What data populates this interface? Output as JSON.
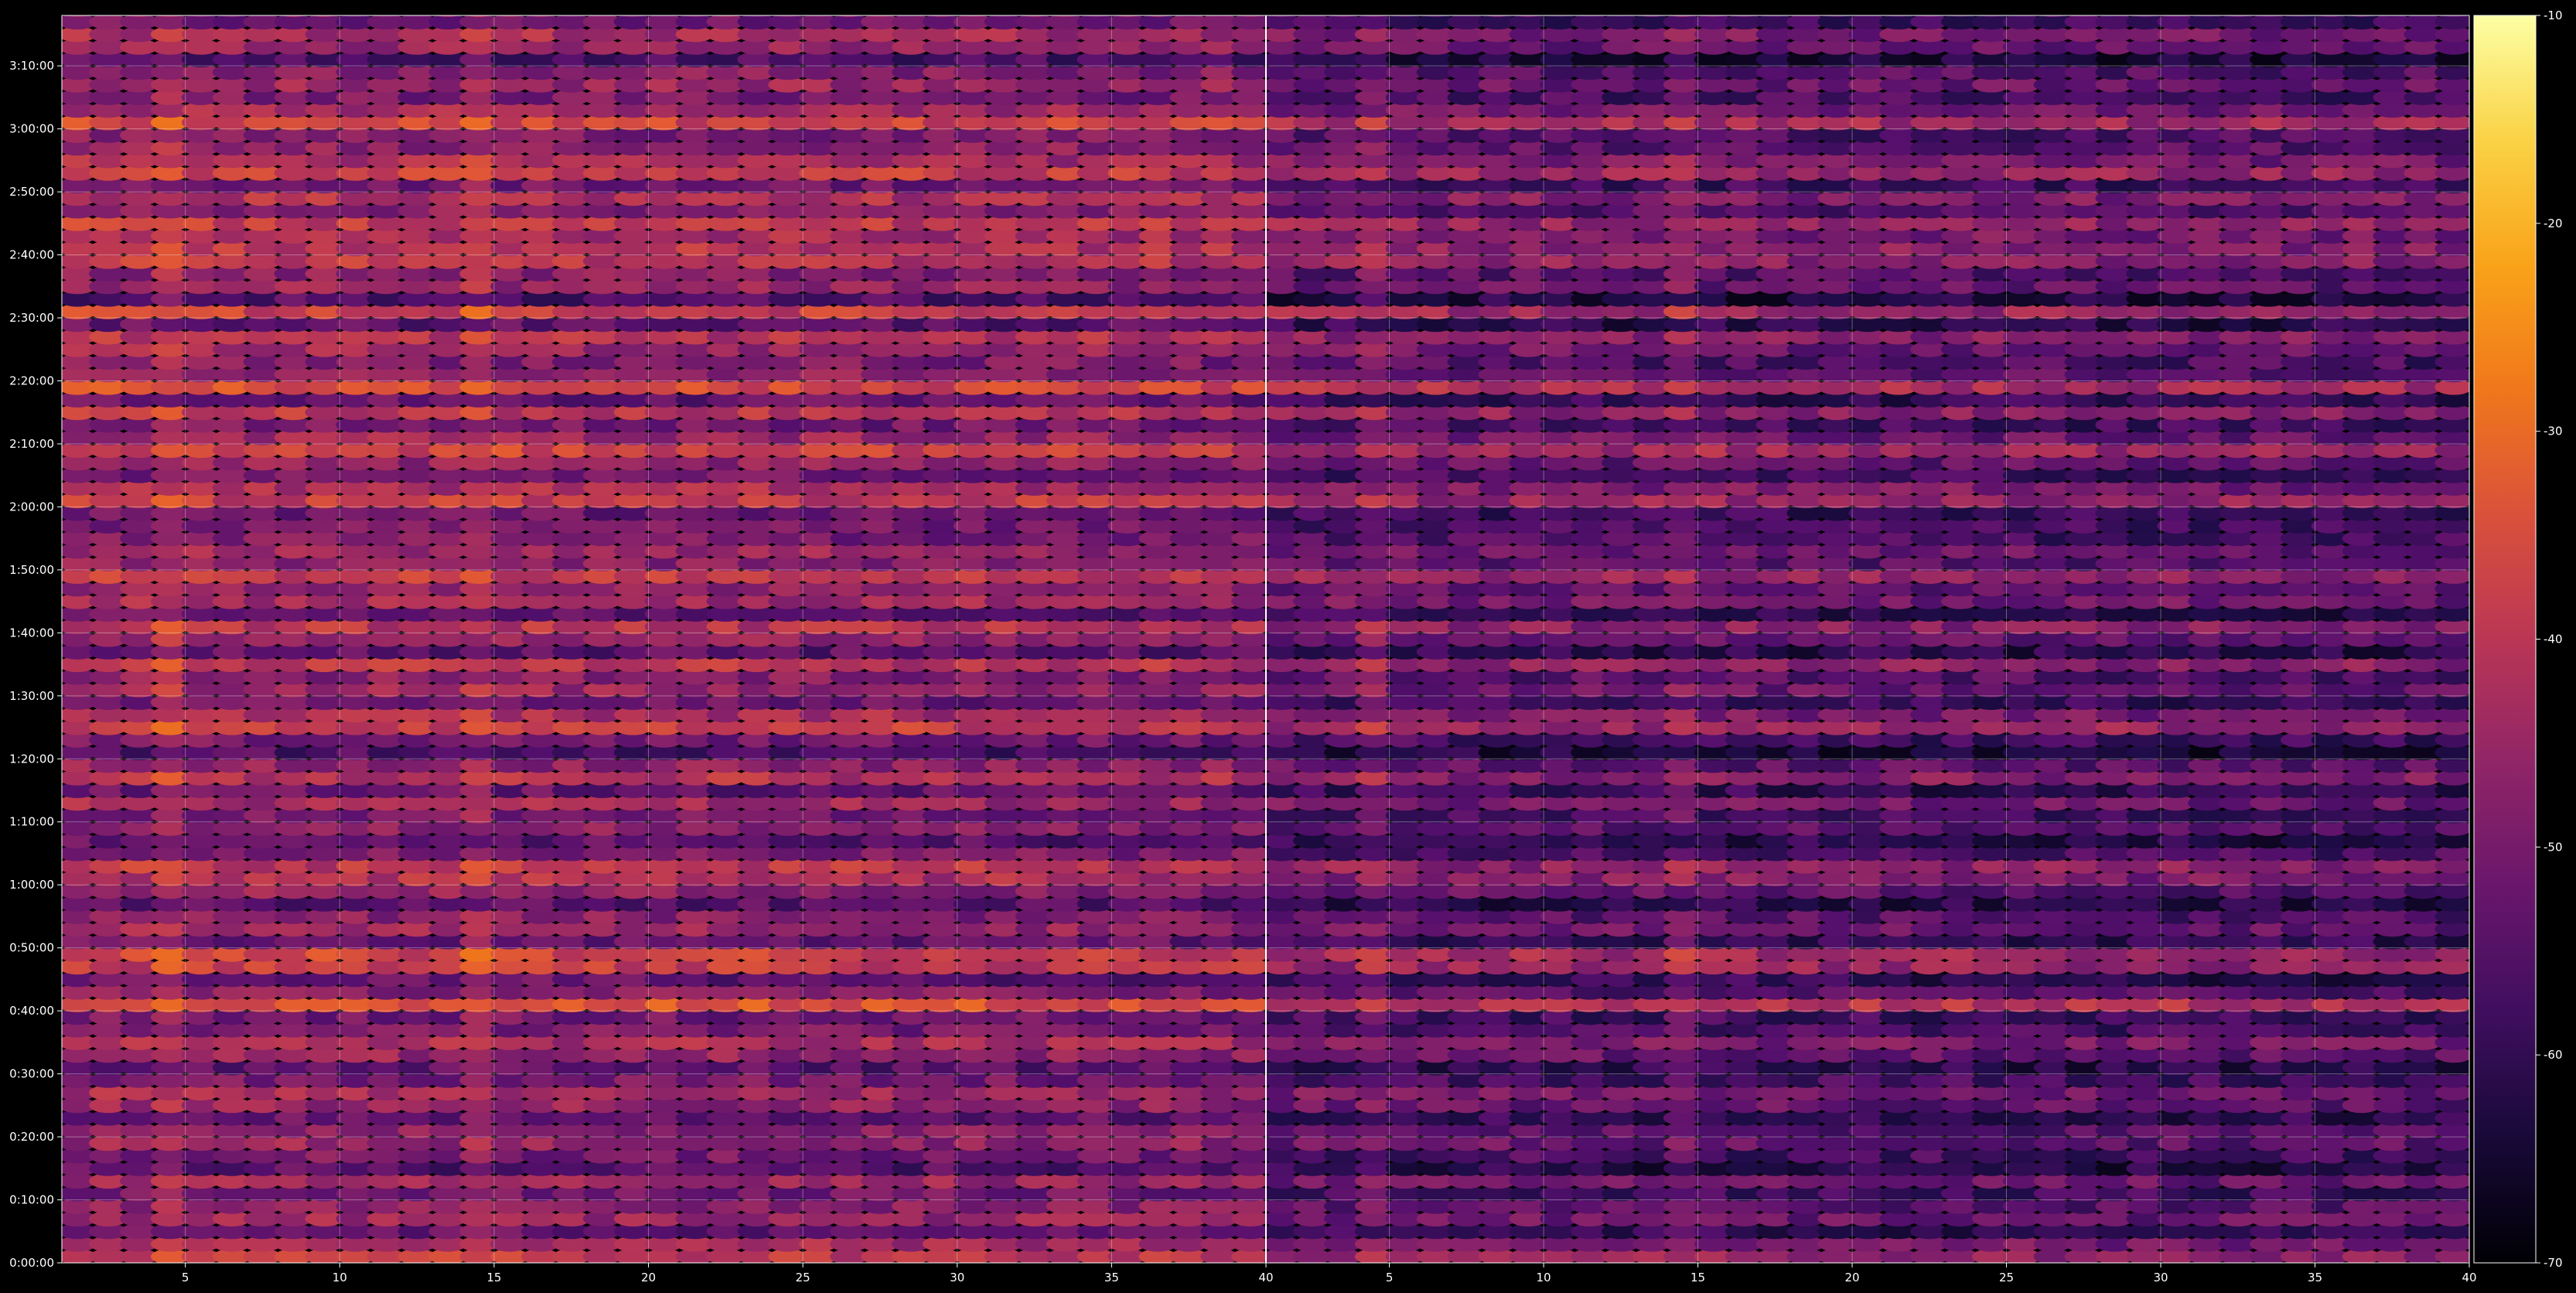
{
  "chart_data": {
    "type": "heatmap",
    "title": "",
    "xlabel": "",
    "ylabel": "",
    "colormap": "inferno",
    "colorbar": {
      "range": [
        -70,
        -10
      ],
      "ticks": [
        -10,
        -20,
        -30,
        -40,
        -50,
        -60,
        -70
      ],
      "tick_labels": [
        "-10",
        "-20",
        "-30",
        "-40",
        "-50",
        "-60",
        "-70"
      ]
    },
    "grid": true,
    "panels": [
      {
        "name": "left",
        "xlim": [
          1,
          40
        ],
        "x_ticks": [
          5,
          10,
          15,
          20,
          25,
          30,
          35,
          40
        ],
        "x_tick_labels": [
          "5",
          "10",
          "15",
          "20",
          "25",
          "30",
          "35",
          "40"
        ],
        "intensity_offset": 0
      },
      {
        "name": "right",
        "xlim": [
          1,
          40
        ],
        "x_ticks": [
          5,
          10,
          15,
          20,
          25,
          30,
          35,
          40
        ],
        "x_tick_labels": [
          "5",
          "10",
          "15",
          "20",
          "25",
          "30",
          "35",
          "40"
        ],
        "intensity_offset": -7
      }
    ],
    "y_ticks_seconds": [
      0,
      600,
      1200,
      1800,
      2400,
      3000,
      3600,
      4200,
      4800,
      5400,
      6000,
      6600,
      7200,
      7800,
      8400,
      9000,
      9600,
      10200,
      10800,
      11400
    ],
    "y_tick_labels": [
      "0:00:00",
      "0:10:00",
      "0:20:00",
      "0:30:00",
      "0:40:00",
      "0:50:00",
      "1:00:00",
      "1:10:00",
      "1:20:00",
      "1:30:00",
      "1:40:00",
      "1:50:00",
      "2:00:00",
      "2:10:00",
      "2:20:00",
      "2:30:00",
      "2:40:00",
      "2:50:00",
      "3:00:00",
      "3:10:00"
    ],
    "ylim_seconds": [
      0,
      11880
    ],
    "row_time_step_seconds": 120,
    "columns": 39,
    "row_profile_db": [
      -38,
      -42,
      -52,
      -44,
      -46,
      -50,
      -44,
      -54,
      -49,
      -45,
      -47,
      -52,
      -45,
      -43,
      -49,
      -53,
      -45,
      -42,
      -49,
      -50,
      -33,
      -47,
      -52,
      -38,
      -36,
      -51,
      -44,
      -47,
      -54,
      -46,
      -41,
      -39,
      -48,
      -53,
      -47,
      -49,
      -43,
      -52,
      -40,
      -46,
      -55,
      -50,
      -37,
      -42,
      -51,
      -44,
      -47,
      -39,
      -53,
      -45,
      -40,
      -52,
      -43,
      -46,
      -38,
      -47,
      -44,
      -49,
      -50,
      -51,
      -38,
      -42,
      -50,
      -46,
      -36,
      -44,
      -50,
      -39,
      -52,
      -35,
      -45,
      -48,
      -44,
      -40,
      -53,
      -37,
      -55,
      -45,
      -47,
      -39,
      -40,
      -42,
      -38,
      -47,
      -41,
      -50,
      -37,
      -42,
      -46,
      -48,
      -36,
      -43,
      -49,
      -44,
      -47,
      -55,
      -45,
      -42,
      -50,
      -47
    ]
  }
}
